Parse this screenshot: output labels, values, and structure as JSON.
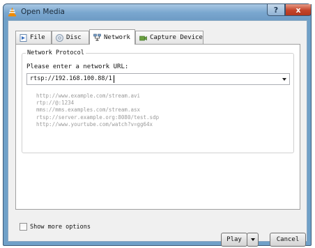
{
  "window": {
    "title": "Open Media",
    "help_label": "?",
    "close_label": "x"
  },
  "tabs": [
    {
      "label": "File",
      "icon": "file-icon"
    },
    {
      "label": "Disc",
      "icon": "disc-icon"
    },
    {
      "label": "Network",
      "icon": "network-icon",
      "active": true
    },
    {
      "label": "Capture Device",
      "icon": "capture-device-icon"
    }
  ],
  "network": {
    "group_title": "Network Protocol",
    "prompt": "Please enter a network URL:",
    "url_value": "rtsp://192.168.100.88/1",
    "examples": [
      "http://www.example.com/stream.avi",
      "rtp://@:1234",
      "mms://mms.examples.com/stream.asx",
      "rtsp://server.example.org:8080/test.sdp",
      "http://www.yourtube.com/watch?v=gg64x"
    ]
  },
  "footer": {
    "more_options_label": "Show more options",
    "more_options_checked": false,
    "play_label": "Play",
    "cancel_label": "Cancel"
  },
  "colors": {
    "titlebar": "#7aa7cf",
    "close_button": "#c4442a",
    "vlc_cone": "#f08a00"
  }
}
